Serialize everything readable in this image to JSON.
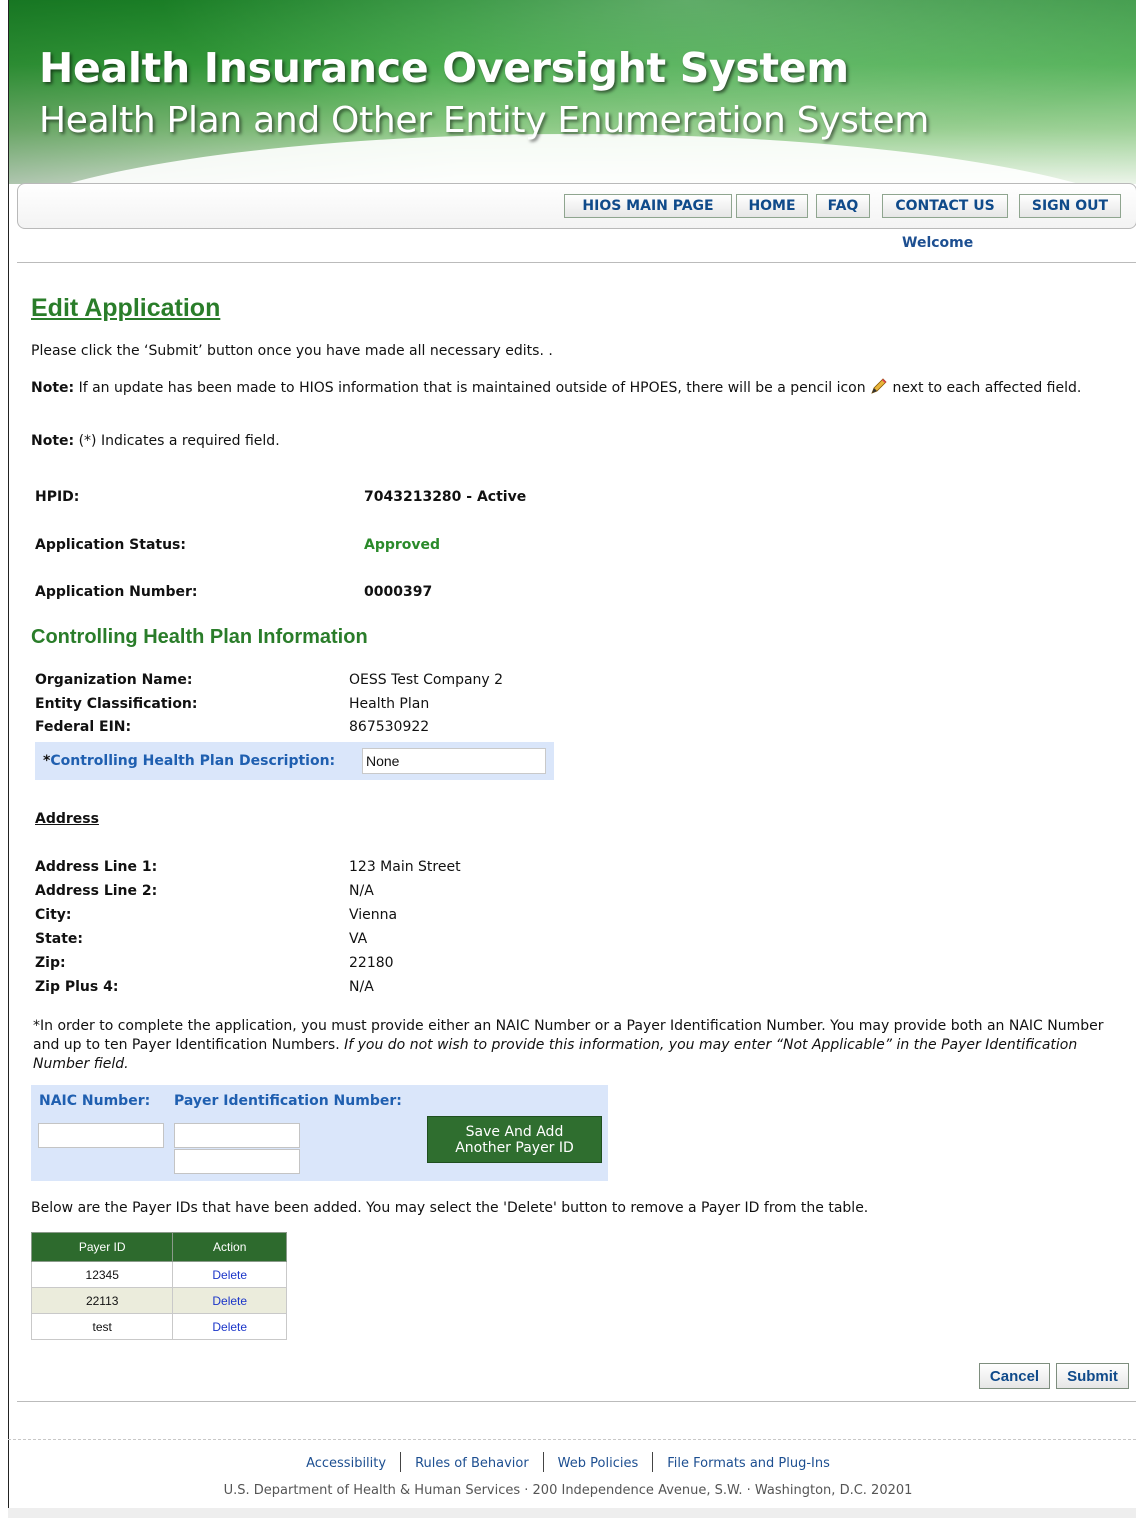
{
  "header": {
    "title": "Health Insurance Oversight System",
    "subtitle": "Health Plan and Other Entity Enumeration System"
  },
  "nav": {
    "hios_main": "HIOS MAIN PAGE",
    "home": "HOME",
    "faq": "FAQ",
    "contact": "CONTACT US",
    "sign_out": "SIGN OUT",
    "welcome": "Welcome"
  },
  "page": {
    "title": "Edit Application",
    "instruction": "Please click the ‘Submit’ button once you have made all necessary edits. .",
    "note1_label": "Note:",
    "note1_text_a": " If an update has been made to HIOS information that is maintained outside of HPOES, there will be a pencil icon",
    "note1_text_b": " next to each affected field.",
    "note2_label": "Note:",
    "note2_text": " (*) Indicates a required field."
  },
  "summary": {
    "hpid_label": "HPID:",
    "hpid_value": "7043213280 - Active",
    "status_label": "Application Status:",
    "status_value": "Approved",
    "number_label": "Application Number:",
    "number_value": "0000397"
  },
  "controlling": {
    "section_title": "Controlling Health Plan Information",
    "org_label": "Organization Name:",
    "org_value": "OESS Test Company 2",
    "class_label": "Entity Classification:",
    "class_value": "Health Plan",
    "ein_label": "Federal EIN:",
    "ein_value": "867530922",
    "desc_star": "*",
    "desc_label": "Controlling Health Plan Description:",
    "desc_value": "None"
  },
  "address": {
    "title": "Address",
    "line1_label": "Address Line 1:",
    "line1_value": "123 Main Street",
    "line2_label": "Address Line 2:",
    "line2_value": "N/A",
    "city_label": "City:",
    "city_value": "Vienna",
    "state_label": "State:",
    "state_value": "VA",
    "zip_label": "Zip:",
    "zip_value": "22180",
    "zip4_label": "Zip Plus 4:",
    "zip4_value": "N/A"
  },
  "payer_info": {
    "text_normal": "*In order to complete the application, you must provide either an NAIC Number or a Payer Identification Number. You may provide both an NAIC Number and up to ten Payer Identification Numbers. ",
    "text_italic": "If you do not wish to provide this information, you may enter “Not Applicable” in the Payer Identification Number field.",
    "naic_label": "NAIC Number:",
    "payer_label": "Payer Identification Number:",
    "naic_value": "",
    "payer_value_1": "",
    "payer_value_2": "",
    "save_btn_line1": "Save And Add",
    "save_btn_line2": "Another Payer ID",
    "table_intro": "Below are the Payer IDs that have been added. You may select the 'Delete' button to remove a Payer ID from the table."
  },
  "payer_table": {
    "col_payer": "Payer ID",
    "col_action": "Action",
    "rows": [
      {
        "id": "12345",
        "action": "Delete"
      },
      {
        "id": "22113",
        "action": "Delete"
      },
      {
        "id": "test",
        "action": "Delete"
      }
    ]
  },
  "actions": {
    "cancel": "Cancel",
    "submit": "Submit"
  },
  "footer": {
    "link1": "Accessibility",
    "link2": "Rules of Behavior",
    "link3": "Web Policies",
    "link4": "File Formats and Plug-Ins",
    "address": "U.S. Department of Health & Human Services · 200 Independence Avenue, S.W. · Washington, D.C. 20201"
  },
  "icons": {
    "pencil": "pencil-icon"
  }
}
